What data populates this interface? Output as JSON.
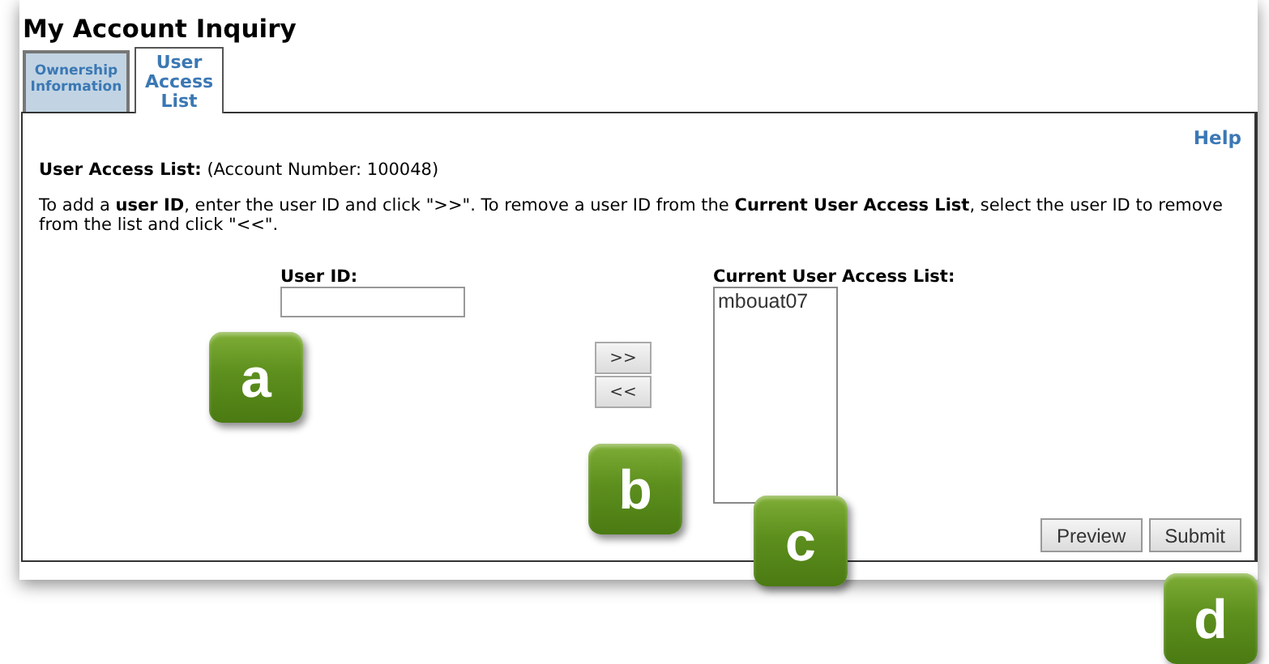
{
  "window": {
    "title": "My Account Inquiry"
  },
  "tabs": [
    {
      "label": "Ownership Information",
      "selected": false
    },
    {
      "label": "User Access List",
      "selected": true
    }
  ],
  "help_link": "Help",
  "heading": {
    "label": "User Access List:",
    "detail": "(Account Number: 100048)"
  },
  "instructions": "To add a **user ID**, enter the user ID and click \">>\". To remove a user ID from the **Current User Access List**, select the user ID to remove from the list and click \"<<\".",
  "user_id_field": {
    "label": "User ID:"
  },
  "move_buttons": [
    ">>",
    "<<"
  ],
  "access_list": {
    "label": "Current User Access List:",
    "items": [
      {
        "text": "mbouat07",
        "selected": false
      }
    ]
  },
  "action_buttons": [
    "Preview",
    "Submit"
  ],
  "callouts": [
    "a",
    "b",
    "c",
    "d"
  ]
}
